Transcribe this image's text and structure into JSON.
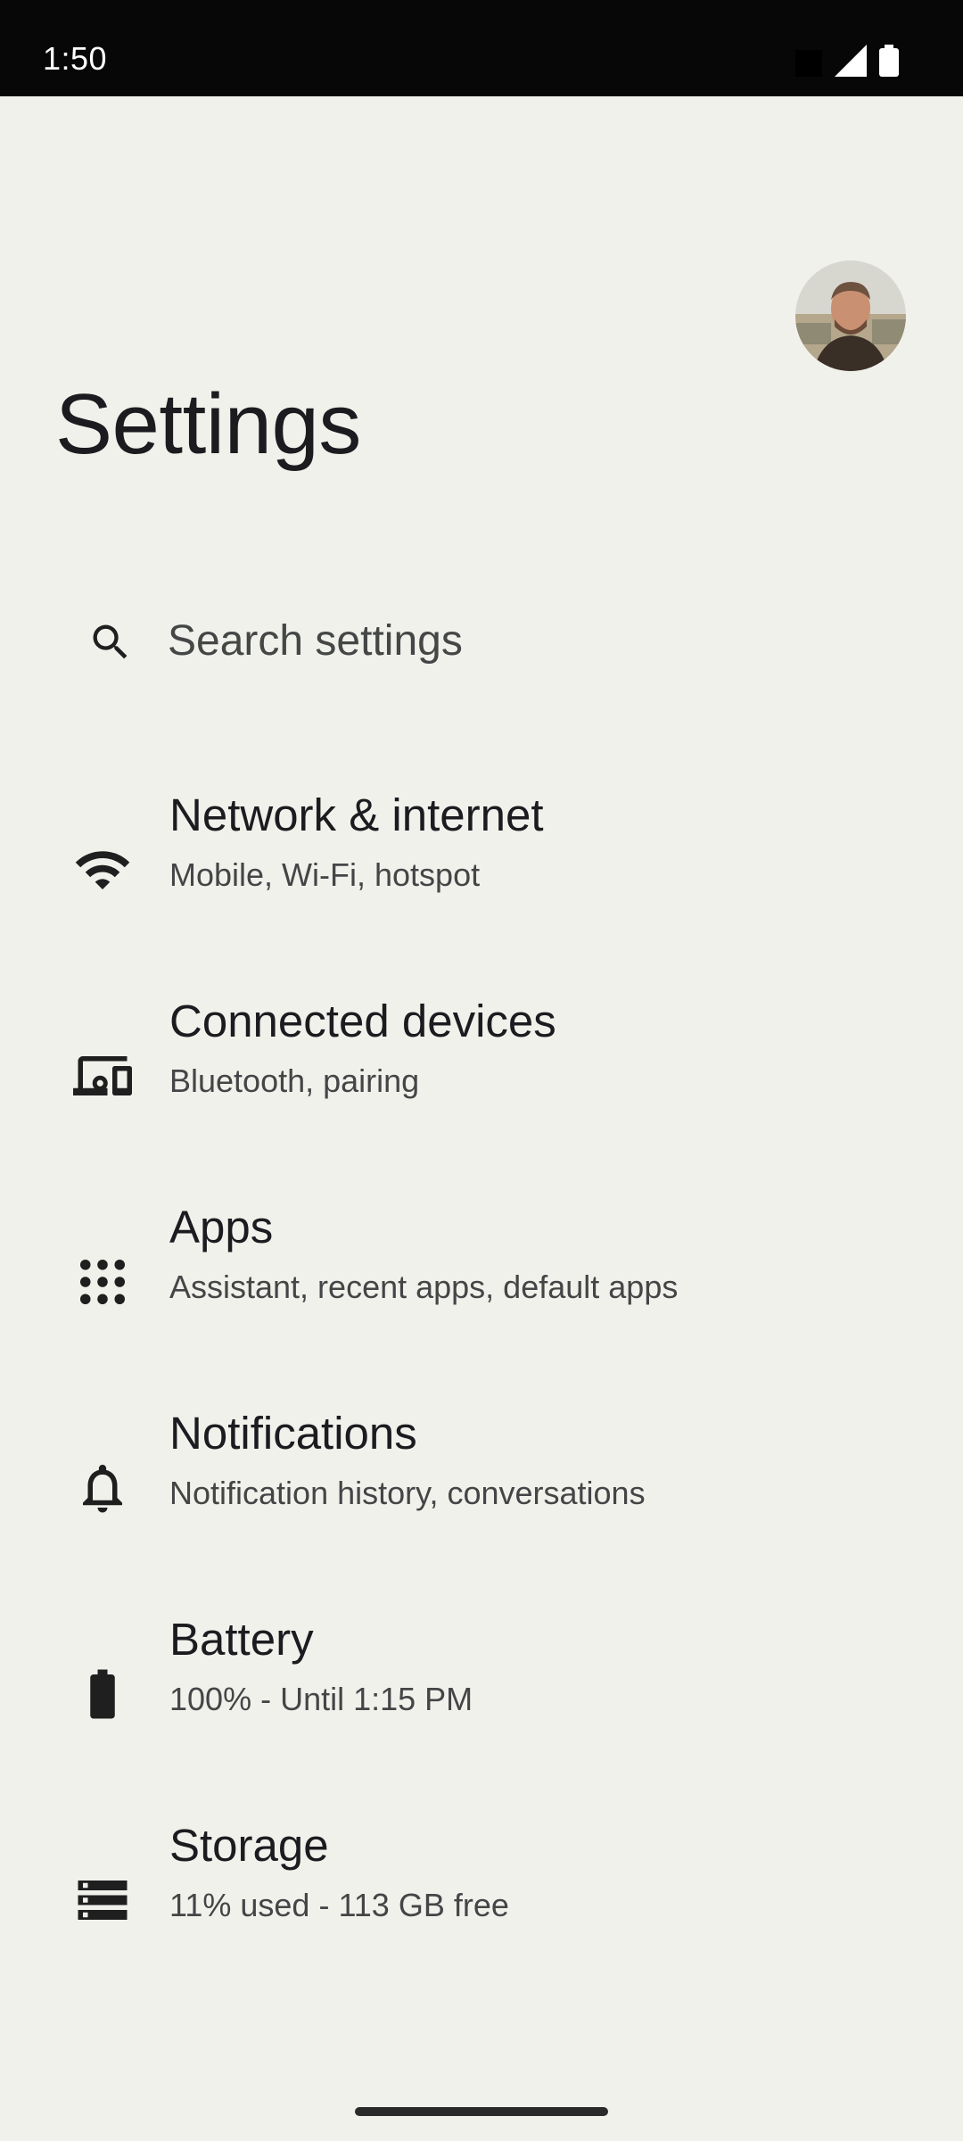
{
  "status_bar": {
    "time": "1:50",
    "icons": [
      "notification-square-icon",
      "cellular-signal-icon",
      "battery-icon"
    ]
  },
  "header": {
    "title": "Settings",
    "avatar": "profile-photo"
  },
  "search": {
    "placeholder": "Search settings",
    "icon": "search-icon"
  },
  "settings": {
    "items": [
      {
        "title": "Network & internet",
        "subtitle": "Mobile, Wi-Fi, hotspot",
        "icon": "wifi-icon"
      },
      {
        "title": "Connected devices",
        "subtitle": "Bluetooth, pairing",
        "icon": "devices-icon"
      },
      {
        "title": "Apps",
        "subtitle": "Assistant, recent apps, default apps",
        "icon": "apps-grid-icon"
      },
      {
        "title": "Notifications",
        "subtitle": "Notification history, conversations",
        "icon": "bell-icon"
      },
      {
        "title": "Battery",
        "subtitle": "100% - Until 1:15 PM",
        "icon": "battery-icon"
      },
      {
        "title": "Storage",
        "subtitle": "11% used - 113 GB free",
        "icon": "storage-icon"
      }
    ]
  },
  "colors": {
    "background": "#f1f1ec",
    "status_bar": "#070708",
    "text_primary": "#1c1b1f",
    "text_secondary": "#454547"
  }
}
